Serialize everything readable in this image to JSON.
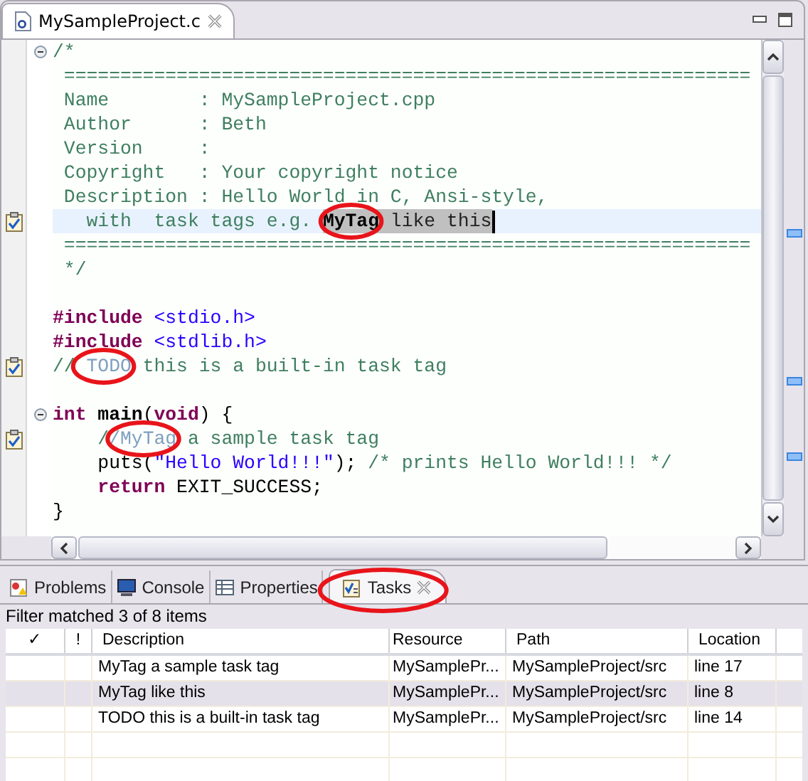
{
  "editor": {
    "tab": {
      "title": "MySampleProject.c",
      "selected": true
    },
    "lines": [
      {
        "task": false,
        "fold": true,
        "current": false,
        "segments": [
          {
            "kind": "comment",
            "text": "/*"
          }
        ]
      },
      {
        "task": false,
        "fold": false,
        "current": false,
        "segments": [
          {
            "kind": "comment",
            "text": " ============================================================="
          }
        ]
      },
      {
        "task": false,
        "fold": false,
        "current": false,
        "segments": [
          {
            "kind": "comment",
            "text": " Name        : MySampleProject.cpp"
          }
        ]
      },
      {
        "task": false,
        "fold": false,
        "current": false,
        "segments": [
          {
            "kind": "comment",
            "text": " Author      : Beth"
          }
        ]
      },
      {
        "task": false,
        "fold": false,
        "current": false,
        "segments": [
          {
            "kind": "comment",
            "text": " Version     :"
          }
        ]
      },
      {
        "task": false,
        "fold": false,
        "current": false,
        "segments": [
          {
            "kind": "comment",
            "text": " Copyright   : Your copyright notice"
          }
        ]
      },
      {
        "task": false,
        "fold": false,
        "current": false,
        "segments": [
          {
            "kind": "comment",
            "text": " Description : Hello World in C, Ansi-style,"
          }
        ]
      },
      {
        "task": true,
        "fold": false,
        "current": true,
        "segments": [
          {
            "kind": "comment",
            "text": "   with  task tags e.g. "
          },
          {
            "kind": "selected-tag",
            "text": "MyTag",
            "circled": true
          },
          {
            "kind": "selected",
            "text": " like this"
          }
        ]
      },
      {
        "task": false,
        "fold": false,
        "current": false,
        "segments": [
          {
            "kind": "comment",
            "text": " ============================================================="
          }
        ]
      },
      {
        "task": false,
        "fold": false,
        "current": false,
        "segments": [
          {
            "kind": "comment",
            "text": " */"
          }
        ]
      },
      {
        "task": false,
        "fold": false,
        "current": false
      },
      {
        "task": false,
        "fold": false,
        "current": false,
        "segments": [
          {
            "kind": "keyword",
            "text": "#include "
          },
          {
            "kind": "string",
            "text": "<stdio.h>"
          }
        ]
      },
      {
        "task": false,
        "fold": false,
        "current": false,
        "segments": [
          {
            "kind": "keyword",
            "text": "#include "
          },
          {
            "kind": "string",
            "text": "<stdlib.h>"
          }
        ]
      },
      {
        "task": true,
        "fold": false,
        "current": false,
        "segments": [
          {
            "kind": "comment",
            "text": "//"
          },
          {
            "kind": "tag",
            "text": " TODO",
            "circled": true
          },
          {
            "kind": "comment",
            "text": " this is a built-in task tag"
          }
        ]
      },
      {
        "task": false,
        "fold": false,
        "current": false
      },
      {
        "task": false,
        "fold": true,
        "current": false,
        "segments": [
          {
            "kind": "keyword",
            "text": "int "
          },
          {
            "kind": "function",
            "text": "main"
          },
          {
            "kind": "plain",
            "text": "("
          },
          {
            "kind": "keyword",
            "text": "void"
          },
          {
            "kind": "plain",
            "text": ") {"
          }
        ]
      },
      {
        "task": true,
        "fold": false,
        "current": false,
        "segments": [
          {
            "kind": "comment",
            "text": "    /"
          },
          {
            "kind": "tag",
            "text": "/MyTag",
            "circled": true
          },
          {
            "kind": "comment",
            "text": " a sample task tag"
          }
        ]
      },
      {
        "task": false,
        "fold": false,
        "current": false,
        "segments": [
          {
            "kind": "plain",
            "text": "    puts("
          },
          {
            "kind": "string",
            "text": "\"Hello World!!!\""
          },
          {
            "kind": "plain",
            "text": "); "
          },
          {
            "kind": "comment",
            "text": "/* prints Hello World!!! */"
          }
        ]
      },
      {
        "task": false,
        "fold": false,
        "current": false,
        "segments": [
          {
            "kind": "keyword",
            "text": "    return"
          },
          {
            "kind": "plain",
            "text": " EXIT_SUCCESS;"
          }
        ]
      },
      {
        "task": false,
        "fold": false,
        "current": false,
        "segments": [
          {
            "kind": "plain",
            "text": "}"
          }
        ]
      }
    ]
  },
  "bottom_panel": {
    "tabs": [
      {
        "label": "Problems",
        "selected": false,
        "circled": false
      },
      {
        "label": "Console",
        "selected": false,
        "circled": false
      },
      {
        "label": "Properties",
        "selected": false,
        "circled": false
      },
      {
        "label": "Tasks",
        "selected": true,
        "circled": true
      }
    ],
    "filter_status": "Filter matched 3 of 8 items",
    "table": {
      "columns": [
        "✓",
        "!",
        "Description",
        "Resource",
        "Path",
        "Location"
      ],
      "rows": [
        {
          "selected": false,
          "description": "MyTag a sample task tag",
          "resource": "MySamplePr...",
          "path": "MySampleProject/src",
          "location": "line 17"
        },
        {
          "selected": true,
          "description": "MyTag like this",
          "resource": "MySamplePr...",
          "path": "MySampleProject/src",
          "location": "line 8"
        },
        {
          "selected": false,
          "description": "TODO this is a built-in task tag",
          "resource": "MySamplePr...",
          "path": "MySampleProject/src",
          "location": "line 14"
        }
      ]
    }
  }
}
